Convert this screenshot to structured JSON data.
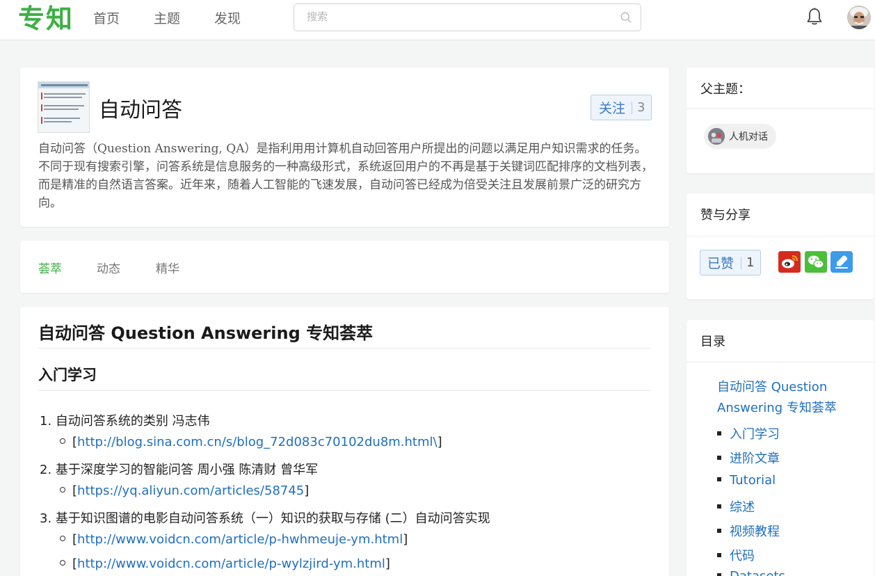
{
  "header": {
    "logo": "专知",
    "nav": [
      "首页",
      "主题",
      "发现"
    ],
    "search_placeholder": "搜索"
  },
  "topic": {
    "title": "自动问答",
    "follow_label": "关注",
    "follow_count": "3",
    "description": "自动问答（Question Answering, QA）是指利用用计算机自动回答用户所提出的问题以满足用户知识需求的任务。不同于现有搜索引擎，问答系统是信息服务的一种高级形式，系统返回用户的不再是基于关键词匹配排序的文档列表，而是精准的自然语言答案。近年来，随着人工智能的飞速发展，自动问答已经成为倍受关注且发展前景广泛的研究方向。"
  },
  "tabs": [
    "荟萃",
    "动态",
    "精华"
  ],
  "content": {
    "heading": "自动问答 Question Answering 专知荟萃",
    "section": "入门学习",
    "items": [
      {
        "num": "1.",
        "text": "自动问答系统的类别 冯志伟",
        "links": [
          "http://blog.sina.com.cn/s/blog_72d083c70102du8m.html\\"
        ]
      },
      {
        "num": "2.",
        "text": "基于深度学习的智能问答 周小强 陈清财 曾华军",
        "links": [
          "https://yq.aliyun.com/articles/58745"
        ]
      },
      {
        "num": "3.",
        "text": "基于知识图谱的电影自动问答系统（一）知识的获取与存储 (二）自动问答实现",
        "links": [
          "http://www.voidcn.com/article/p-hwhmeuje-ym.html",
          "http://www.voidcn.com/article/p-wylzjird-ym.html"
        ]
      }
    ]
  },
  "sidebar": {
    "parent_title": "父主题：",
    "parent_topic": "人机对话",
    "share_title": "赞与分享",
    "liked_label": "已赞",
    "liked_count": "1",
    "toc_title": "目录",
    "toc_top": "自动问答 Question Answering 专知荟萃",
    "toc_items": [
      "入门学习",
      "进阶文章",
      "Tutorial",
      "综述",
      "视频教程",
      "代码",
      "Datasets"
    ]
  },
  "colors": {
    "brand_green": "#3cb043",
    "link_blue": "#1f6fbf",
    "weibo": "#d52b1e",
    "wechat": "#4bbf3a",
    "blue_share": "#3d9be9"
  }
}
